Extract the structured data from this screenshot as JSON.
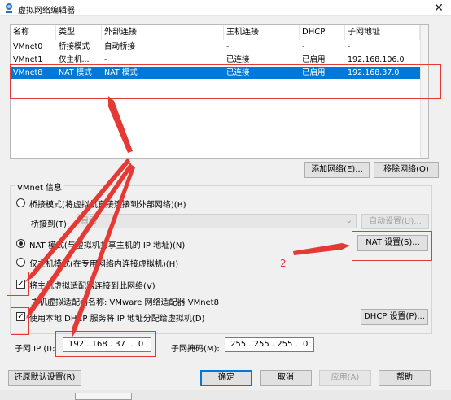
{
  "window": {
    "title": "虚拟网络编辑器",
    "close_glyph": "✕"
  },
  "list": {
    "columns": [
      "名称",
      "类型",
      "外部连接",
      "主机连接",
      "DHCP",
      "子网地址"
    ],
    "rows": [
      {
        "name": "VMnet0",
        "type": "桥接模式",
        "external": "自动桥接",
        "host": "-",
        "dhcp": "-",
        "subnet": "-"
      },
      {
        "name": "VMnet1",
        "type": "仅主机...",
        "external": "-",
        "host": "已连接",
        "dhcp": "已启用",
        "subnet": "192.168.106.0"
      },
      {
        "name": "VMnet8",
        "type": "NAT 模式",
        "external": "NAT 模式",
        "host": "已连接",
        "dhcp": "已启用",
        "subnet": "192.168.37.0"
      }
    ],
    "selected_index": 2
  },
  "buttons": {
    "add_network": "添加网络(E)...",
    "remove_network": "移除网络(O)",
    "auto_settings": "自动设置(U)...",
    "nat_settings": "NAT 设置(S)...",
    "dhcp_settings": "DHCP 设置(P)...",
    "restore_defaults": "还原默认设置(R)",
    "ok": "确定",
    "cancel": "取消",
    "apply": "应用(A)",
    "help": "帮助"
  },
  "vmnet_info": {
    "group_title": "VMnet 信息",
    "bridge_mode_label": "桥接模式(将虚拟机直接连接到外部网络)(B)",
    "bridge_to_label": "桥接到(T):",
    "bridge_to_value": "自动",
    "nat_mode_label": "NAT 模式(与虚拟机共享主机的 IP 地址)(N)",
    "host_only_label": "仅主机模式(在专用网络内连接虚拟机)(H)",
    "selected_mode": "nat",
    "connect_adapter_label": "将主机虚拟适配器连接到此网络(V)",
    "connect_adapter_checked": true,
    "adapter_name_label": "主机虚拟适配器名称: VMware 网络适配器 VMnet8",
    "use_dhcp_label": "使用本地 DHCP 服务将 IP 地址分配给虚拟机(D)",
    "use_dhcp_checked": true,
    "subnet_ip_label": "子网 IP (I):",
    "subnet_ip_value": "192 . 168 . 37  .  0",
    "subnet_mask_label": "子网掩码(M):",
    "subnet_mask_value": "255 . 255 . 255 .  0"
  },
  "annotations": {
    "number_label": "2",
    "color": "#e53935"
  },
  "colors": {
    "selection": "#0078d7",
    "annotation_red": "#e53935"
  }
}
